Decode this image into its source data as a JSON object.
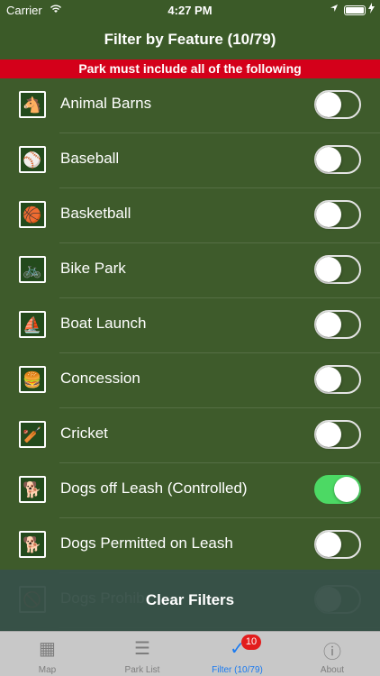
{
  "status": {
    "carrier": "Carrier",
    "wifi_icon": "wifi-icon",
    "time": "4:27 PM",
    "location_icon": "location-arrow-icon",
    "battery_icon": "battery-charging-icon"
  },
  "header": {
    "title": "Filter by Feature (10/79)"
  },
  "banner": {
    "text": "Park must include all of the following"
  },
  "features": [
    {
      "label": "Animal Barns",
      "icon": "barn-icon",
      "glyph": "🐴",
      "on": false
    },
    {
      "label": "Baseball",
      "icon": "baseball-icon",
      "glyph": "⚾",
      "on": false
    },
    {
      "label": "Basketball",
      "icon": "basketball-icon",
      "glyph": "🏀",
      "on": false
    },
    {
      "label": "Bike Park",
      "icon": "bike-icon",
      "glyph": "🚲",
      "on": false
    },
    {
      "label": "Boat Launch",
      "icon": "sailboat-icon",
      "glyph": "⛵",
      "on": false
    },
    {
      "label": "Concession",
      "icon": "concession-icon",
      "glyph": "🍔",
      "on": false
    },
    {
      "label": "Cricket",
      "icon": "cricket-icon",
      "glyph": "🏏",
      "on": false
    },
    {
      "label": "Dogs off Leash (Controlled)",
      "icon": "dog-icon",
      "glyph": "🐕",
      "on": true
    },
    {
      "label": "Dogs Permitted on Leash",
      "icon": "dog-leash-icon",
      "glyph": "🐕",
      "on": false
    },
    {
      "label": "Dogs Prohib",
      "icon": "dog-prohibited-icon",
      "glyph": "🚫",
      "on": false
    }
  ],
  "clear_button": {
    "label": "Clear Filters"
  },
  "tabs": [
    {
      "label": "Map",
      "icon": "map-icon",
      "glyph": "▦",
      "active": false
    },
    {
      "label": "Park List",
      "icon": "list-icon",
      "glyph": "☰",
      "active": false
    },
    {
      "label": "Filter (10/79)",
      "icon": "checkbox-icon",
      "glyph": "✓",
      "active": true,
      "badge": "10"
    },
    {
      "label": "About",
      "icon": "info-icon",
      "glyph": "ⓘ",
      "active": false
    }
  ]
}
